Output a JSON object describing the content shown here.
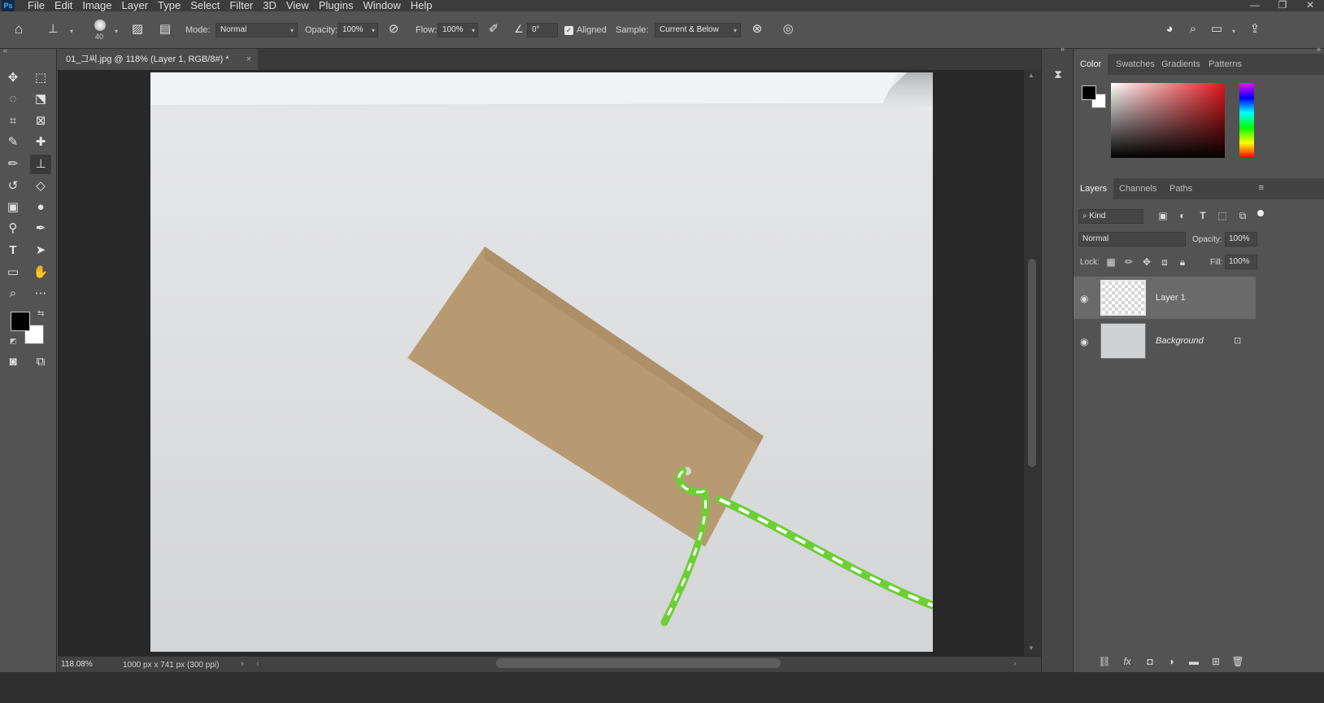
{
  "app": {
    "logo": "Ps"
  },
  "menu": [
    "File",
    "Edit",
    "Image",
    "Layer",
    "Type",
    "Select",
    "Filter",
    "3D",
    "View",
    "Plugins",
    "Window",
    "Help"
  ],
  "options": {
    "brush_size": "40",
    "mode_label": "Mode:",
    "mode_value": "Normal",
    "opacity_label": "Opacity:",
    "opacity_value": "100%",
    "flow_label": "Flow:",
    "flow_value": "100%",
    "angle_value": "0°",
    "aligned_label": "Aligned",
    "aligned_checked": true,
    "sample_label": "Sample:",
    "sample_value": "Current & Below"
  },
  "document": {
    "tab_title": "01_그씨.jpg @ 118% (Layer 1, RGB/8#) *",
    "zoom": "118.08%",
    "doc_info": "1000 px x 741 px (300 ppi)"
  },
  "color_panel": {
    "tabs": [
      "Color",
      "Swatches",
      "Gradients",
      "Patterns"
    ],
    "active_tab": "Color",
    "foreground": "#000000",
    "background": "#ffffff"
  },
  "layers_panel": {
    "tabs": [
      "Layers",
      "Channels",
      "Paths"
    ],
    "active_tab": "Layers",
    "filter_label": "Kind",
    "blend_mode": "Normal",
    "opacity_label": "Opacity:",
    "opacity_value": "100%",
    "lock_label": "Lock:",
    "fill_label": "Fill:",
    "fill_value": "100%",
    "layers": [
      {
        "name": "Layer 1",
        "visible": true,
        "selected": true,
        "locked": false
      },
      {
        "name": "Background",
        "visible": true,
        "selected": false,
        "locked": true
      }
    ]
  },
  "colors": {
    "ui_bg": "#535353",
    "canvas_bg": "#282828",
    "accent": "#4ab1ff",
    "paper": "#d9dadc",
    "tag": "#b89a72",
    "string_green": "#6ccf35"
  }
}
